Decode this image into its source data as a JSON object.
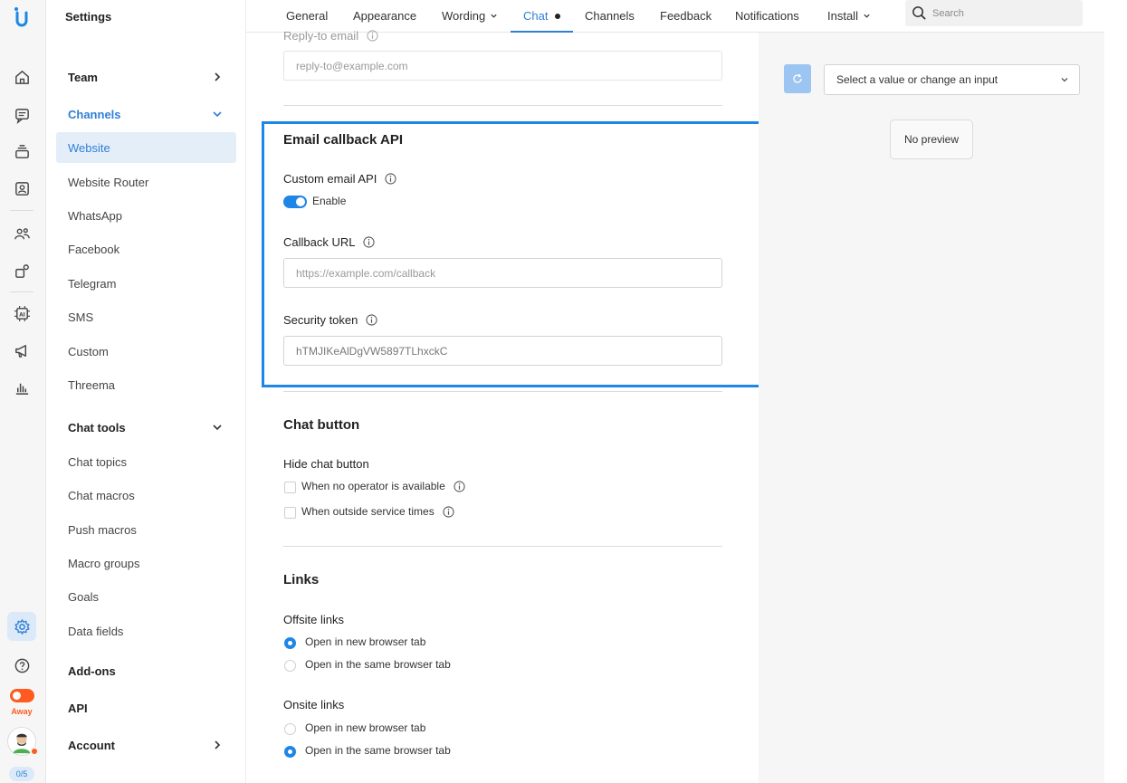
{
  "rail": {
    "status_label": "Away",
    "agent_count": "0/5",
    "icons": [
      "logo-icon",
      "home-icon",
      "chat-icon",
      "inbox-stack-icon",
      "contacts-icon",
      "team-icon",
      "apps-icon",
      "ai-chip-icon",
      "megaphone-icon",
      "analytics-icon",
      "settings-icon",
      "help-icon"
    ],
    "accent": "#2f7fd6",
    "away_color": "#ff5a1f"
  },
  "nav": {
    "title": "Settings",
    "items": [
      {
        "label": "Team",
        "type": "group"
      },
      {
        "label": "Channels",
        "type": "group"
      },
      {
        "label": "Website",
        "type": "item"
      },
      {
        "label": "Website Router",
        "type": "item"
      },
      {
        "label": "WhatsApp",
        "type": "item"
      },
      {
        "label": "Facebook",
        "type": "item"
      },
      {
        "label": "Telegram",
        "type": "item"
      },
      {
        "label": "SMS",
        "type": "item"
      },
      {
        "label": "Custom",
        "type": "item"
      },
      {
        "label": "Threema",
        "type": "item"
      },
      {
        "label": "Chat tools",
        "type": "group"
      },
      {
        "label": "Chat topics",
        "type": "item"
      },
      {
        "label": "Chat macros",
        "type": "item"
      },
      {
        "label": "Push macros",
        "type": "item"
      },
      {
        "label": "Macro groups",
        "type": "item"
      },
      {
        "label": "Goals",
        "type": "item"
      },
      {
        "label": "Data fields",
        "type": "item"
      },
      {
        "label": "Add-ons",
        "type": "group"
      },
      {
        "label": "API",
        "type": "group"
      },
      {
        "label": "Account",
        "type": "group"
      }
    ]
  },
  "tabs": {
    "items": [
      "General",
      "Appearance",
      "Wording",
      "Chat",
      "Channels",
      "Feedback",
      "Notifications",
      "Install"
    ],
    "active": "Chat",
    "search_placeholder": "Search"
  },
  "main": {
    "reply_to": {
      "label": "Reply-to email",
      "placeholder": "reply-to@example.com"
    },
    "email_callback": {
      "heading": "Email callback API",
      "custom_api_label": "Custom email API",
      "enable_label": "Enable",
      "enabled": true,
      "callback_url_label": "Callback URL",
      "callback_url_placeholder": "https://example.com/callback",
      "security_token_label": "Security token",
      "security_token_value": "hTMJIKeAlDgVW5897TLhxckC"
    },
    "chat_button": {
      "heading": "Chat button",
      "hide_label": "Hide chat button",
      "option_no_operator": "When no operator is available",
      "option_outside_hours": "When outside service times"
    },
    "links": {
      "heading": "Links",
      "offsite_label": "Offsite links",
      "offsite_new_tab": "Open in new browser tab",
      "offsite_same_tab": "Open in the same browser tab",
      "onsite_label": "Onsite links",
      "onsite_new_tab": "Open in new browser tab",
      "onsite_same_tab": "Open in the same browser tab"
    }
  },
  "preview": {
    "select_placeholder": "Select a value or change an input",
    "no_preview": "No preview"
  }
}
